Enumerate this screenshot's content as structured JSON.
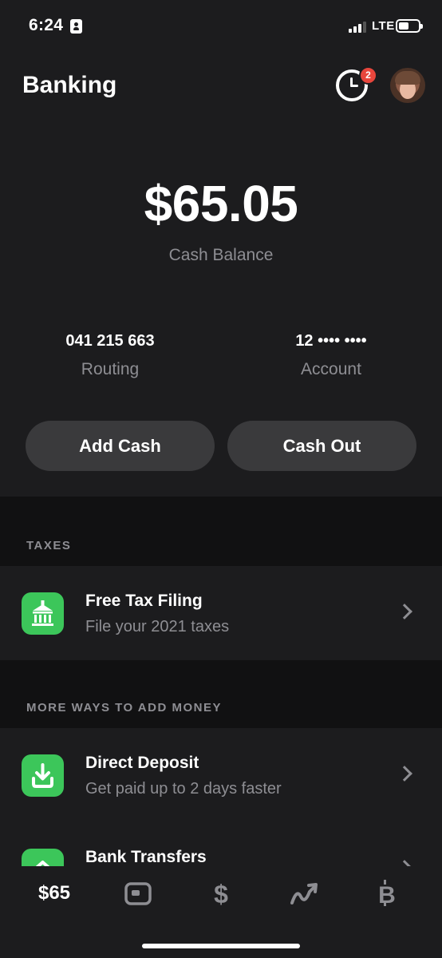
{
  "status_bar": {
    "time": "6:24",
    "network": "LTE",
    "battery_percent": 45,
    "signal_bars": 3
  },
  "header": {
    "title": "Banking",
    "activity_badge": "2"
  },
  "balance": {
    "amount": "$65.05",
    "label": "Cash Balance"
  },
  "account_info": {
    "routing_number": "041 215 663",
    "routing_label": "Routing",
    "account_number": "12 •••• ••••",
    "account_label": "Account"
  },
  "actions": {
    "add_cash": "Add Cash",
    "cash_out": "Cash Out"
  },
  "sections": {
    "taxes": {
      "label": "TAXES",
      "item": {
        "title": "Free Tax Filing",
        "subtitle": "File your 2021 taxes",
        "icon": "bank-building-icon"
      }
    },
    "more_ways": {
      "label": "MORE WAYS TO ADD MONEY",
      "items": [
        {
          "title": "Direct Deposit",
          "subtitle": "Get paid up to 2 days faster",
          "icon": "download-tray-icon"
        },
        {
          "title": "Bank Transfers",
          "subtitle": "",
          "icon": "chevron-up-icon"
        }
      ]
    }
  },
  "bottom_nav": {
    "balance": "$65",
    "items": [
      "balance",
      "card-icon",
      "dollar-icon",
      "investing-chart-icon",
      "bitcoin-icon"
    ]
  },
  "colors": {
    "background": "#1c1c1e",
    "accent_green": "#3cc65a",
    "badge_red": "#e8463c",
    "muted_text": "#8e8e93",
    "button_gray": "#3a3a3c"
  }
}
